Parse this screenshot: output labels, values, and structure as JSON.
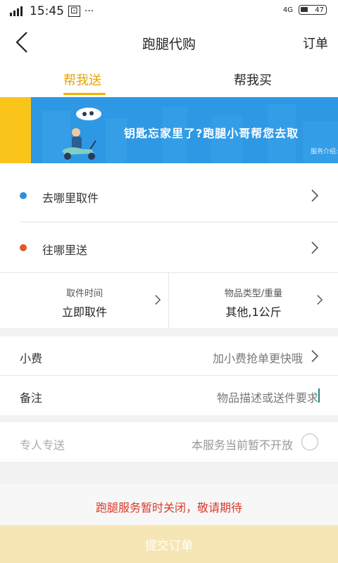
{
  "status_bar": {
    "time": "15:45",
    "network_left": "4G",
    "network_right": "4G",
    "battery": "47",
    "extra": "··· "
  },
  "header": {
    "title": "跑腿代购",
    "orders_link": "订单"
  },
  "tabs": [
    {
      "label": "帮我送",
      "active": true
    },
    {
      "label": "帮我买",
      "active": false
    }
  ],
  "banner": {
    "headline": "钥匙忘家里了?跑腿小哥帮您去取",
    "sub": "服务介绍:"
  },
  "locations": {
    "pickup_label": "去哪里取件",
    "delivery_label": "往哪里送"
  },
  "options": {
    "pickup_time_caption": "取件时间",
    "pickup_time_value": "立即取件",
    "item_type_caption": "物品类型/重量",
    "item_type_value": "其他,1公斤"
  },
  "tip": {
    "label": "小费",
    "hint": "加小费抢单更快哦"
  },
  "remark": {
    "label": "备注",
    "placeholder": "物品描述或送件要求"
  },
  "dedicated": {
    "label": "专人专送",
    "hint": "本服务当前暂不开放"
  },
  "notice": "跑腿服务暂时关闭，敬请期待",
  "submit_label": "提交订单",
  "colors": {
    "accent": "#f2b300",
    "pickup_dot": "#2e8fe0",
    "delivery_dot": "#e4562a",
    "notice": "#d93a2b"
  }
}
